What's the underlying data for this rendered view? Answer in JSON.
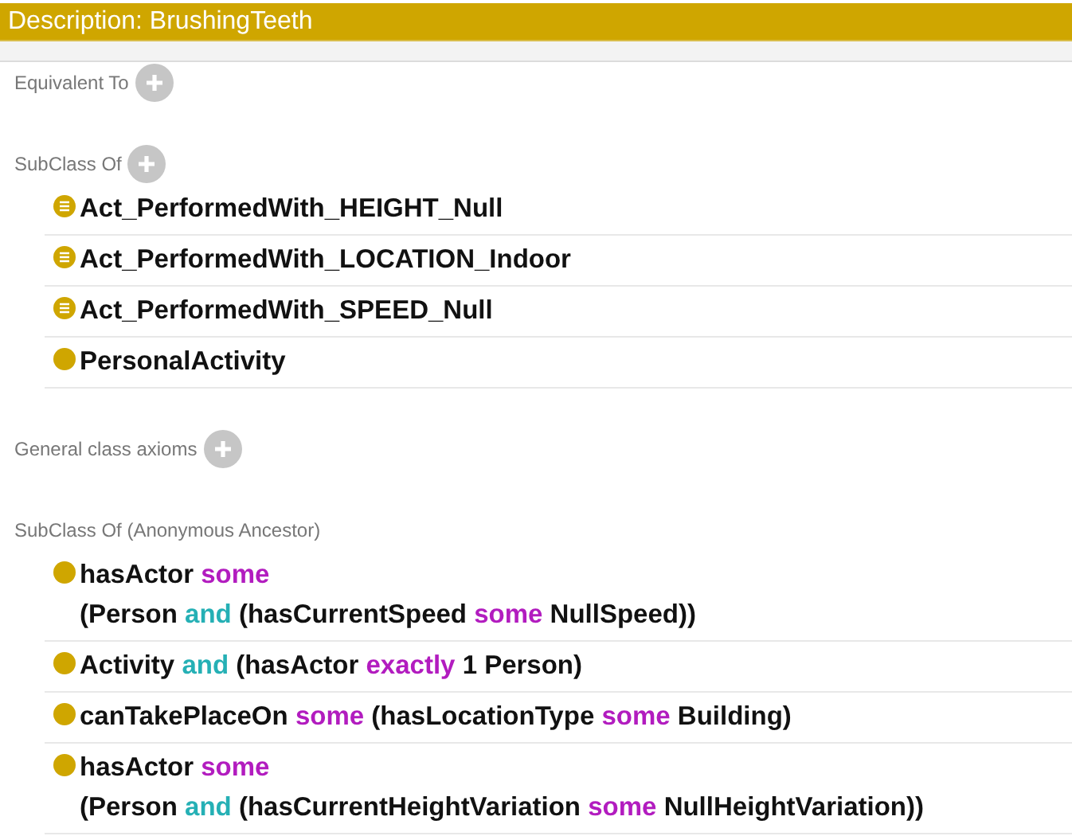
{
  "title": "Description: BrushingTeeth",
  "sections": [
    {
      "heading": "Equivalent To",
      "addable": true
    },
    {
      "heading": "SubClass Of",
      "addable": true,
      "items": [
        {
          "kind": "defined",
          "lines": [
            [
              {
                "text": "Act_PerformedWith_HEIGHT_Null",
                "kind": "name"
              }
            ]
          ]
        },
        {
          "kind": "defined",
          "lines": [
            [
              {
                "text": "Act_PerformedWith_LOCATION_Indoor",
                "kind": "name"
              }
            ]
          ]
        },
        {
          "kind": "defined",
          "lines": [
            [
              {
                "text": "Act_PerformedWith_SPEED_Null",
                "kind": "name"
              }
            ]
          ]
        },
        {
          "kind": "primitive",
          "lines": [
            [
              {
                "text": "PersonalActivity",
                "kind": "name"
              }
            ]
          ]
        }
      ]
    },
    {
      "heading": "General class axioms",
      "addable": true
    },
    {
      "heading": "SubClass Of (Anonymous Ancestor)",
      "addable": false,
      "items": [
        {
          "kind": "primitive",
          "lines": [
            [
              {
                "text": "hasActor",
                "kind": "name"
              },
              {
                "text": "some",
                "kind": "quantifier"
              }
            ],
            [
              {
                "text": "(Person",
                "kind": "name"
              },
              {
                "text": "and",
                "kind": "connective"
              },
              {
                "text": "(hasCurrentSpeed",
                "kind": "name"
              },
              {
                "text": "some",
                "kind": "quantifier"
              },
              {
                "text": "NullSpeed))",
                "kind": "name"
              }
            ]
          ]
        },
        {
          "kind": "primitive",
          "lines": [
            [
              {
                "text": "Activity",
                "kind": "name"
              },
              {
                "text": "and",
                "kind": "connective"
              },
              {
                "text": "(hasActor",
                "kind": "name"
              },
              {
                "text": "exactly",
                "kind": "quantifier"
              },
              {
                "text": "1 Person)",
                "kind": "name"
              }
            ]
          ]
        },
        {
          "kind": "primitive",
          "lines": [
            [
              {
                "text": "canTakePlaceOn",
                "kind": "name"
              },
              {
                "text": "some",
                "kind": "quantifier"
              },
              {
                "text": "(hasLocationType",
                "kind": "name"
              },
              {
                "text": "some",
                "kind": "quantifier"
              },
              {
                "text": "Building)",
                "kind": "name"
              }
            ]
          ]
        },
        {
          "kind": "primitive",
          "lines": [
            [
              {
                "text": "hasActor",
                "kind": "name"
              },
              {
                "text": "some",
                "kind": "quantifier"
              }
            ],
            [
              {
                "text": "(Person",
                "kind": "name"
              },
              {
                "text": "and",
                "kind": "connective"
              },
              {
                "text": "(hasCurrentHeightVariation",
                "kind": "name"
              },
              {
                "text": "some",
                "kind": "quantifier"
              },
              {
                "text": "NullHeightVariation))",
                "kind": "name"
              }
            ]
          ]
        }
      ]
    }
  ]
}
